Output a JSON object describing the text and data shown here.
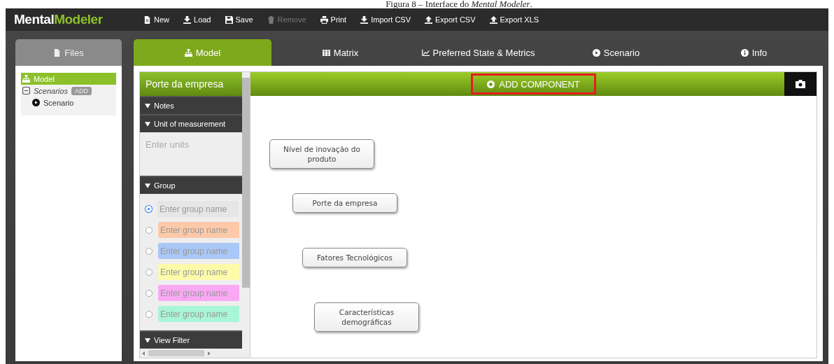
{
  "caption": "Figura 8 – Interface do *Mental Modeler*.",
  "app": {
    "logo_first": "Mental",
    "logo_second": "Modeler"
  },
  "toolbar": [
    {
      "label": "New",
      "disabled": false
    },
    {
      "label": "Load",
      "disabled": false
    },
    {
      "label": "Save",
      "disabled": false
    },
    {
      "label": "Remove",
      "disabled": true
    },
    {
      "label": "Print",
      "disabled": false
    },
    {
      "label": "Import CSV",
      "disabled": false
    },
    {
      "label": "Export CSV",
      "disabled": false
    },
    {
      "label": "Export XLS",
      "disabled": false
    }
  ],
  "files_tab": {
    "label": "Files"
  },
  "tabs": [
    {
      "label": "Model",
      "selected": true
    },
    {
      "label": "Matrix",
      "selected": false
    },
    {
      "label": "Preferred State & Metrics",
      "selected": false
    },
    {
      "label": "Scenario",
      "selected": false
    },
    {
      "label": "Info",
      "selected": false
    }
  ],
  "file_tree": [
    {
      "label": "Model",
      "selected": true
    },
    {
      "label": "Scenarios",
      "selected": false,
      "expanded": true,
      "badge": "ADD",
      "children": [
        {
          "label": "Scenario",
          "selected": false
        }
      ]
    }
  ],
  "component_panel": {
    "title": "Porte da empresa",
    "notes_header": "Notes",
    "unit_header": "Unit of measurement",
    "unit_placeholder": "Enter units",
    "group_header": "Group",
    "groups": [
      {
        "placeholder": "Enter group name",
        "color": "#e6e6e6",
        "selected": true
      },
      {
        "placeholder": "Enter group name",
        "color": "#fdc9a8",
        "selected": false
      },
      {
        "placeholder": "Enter group name",
        "color": "#a9c7f7",
        "selected": false
      },
      {
        "placeholder": "Enter group name",
        "color": "#fdfbaa",
        "selected": false
      },
      {
        "placeholder": "Enter group name",
        "color": "#f9a8f4",
        "selected": false
      },
      {
        "placeholder": "Enter group name",
        "color": "#a8f5d8",
        "selected": false
      }
    ],
    "view_filter_header": "View Filter"
  },
  "canvas": {
    "add_button": {
      "label": "ADD COMPONENT",
      "highlighted": true
    },
    "nodes": [
      {
        "label": "Nível de inovação do produto"
      },
      {
        "label": "Porte da empresa"
      },
      {
        "label": "Fatores Tecnológicos"
      },
      {
        "label": "Características demográficas"
      }
    ]
  }
}
